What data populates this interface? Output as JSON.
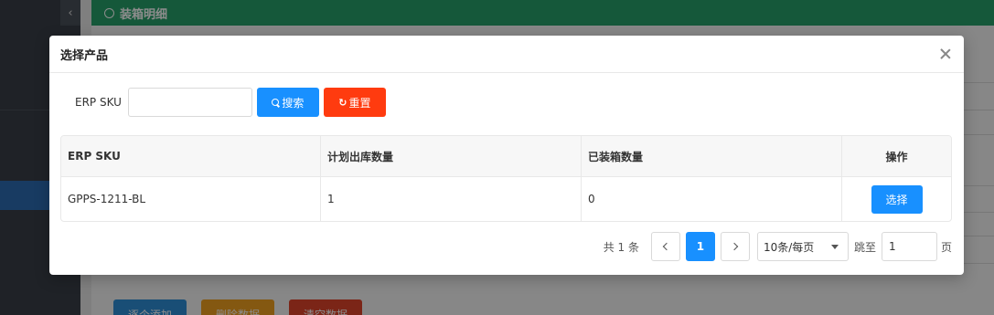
{
  "background": {
    "header_title": "装箱明细",
    "buttons": [
      {
        "label": "逐个添加",
        "color": "#2f8fd8"
      },
      {
        "label": "删除数据",
        "color": "#f0a020"
      },
      {
        "label": "清空数据",
        "color": "#e0442a"
      }
    ]
  },
  "modal": {
    "title": "选择产品",
    "search": {
      "label": "ERP SKU",
      "input_value": "",
      "search_button": "搜索",
      "reset_button": "重置"
    },
    "table": {
      "columns": [
        "ERP SKU",
        "计划出库数量",
        "已装箱数量",
        "操作"
      ],
      "rows": [
        {
          "sku": "GPPS-1211-BL",
          "planned_qty": "1",
          "packed_qty": "0",
          "action": "选择"
        }
      ]
    },
    "pagination": {
      "total": "共 1 条",
      "current_page": "1",
      "page_size": "10条/每页",
      "jump_label": "跳至",
      "jump_value": "1",
      "page_unit": "页"
    }
  },
  "colors": {
    "primary": "#1890ff",
    "danger": "#ff3b0f",
    "header_green": "#27a06a"
  }
}
